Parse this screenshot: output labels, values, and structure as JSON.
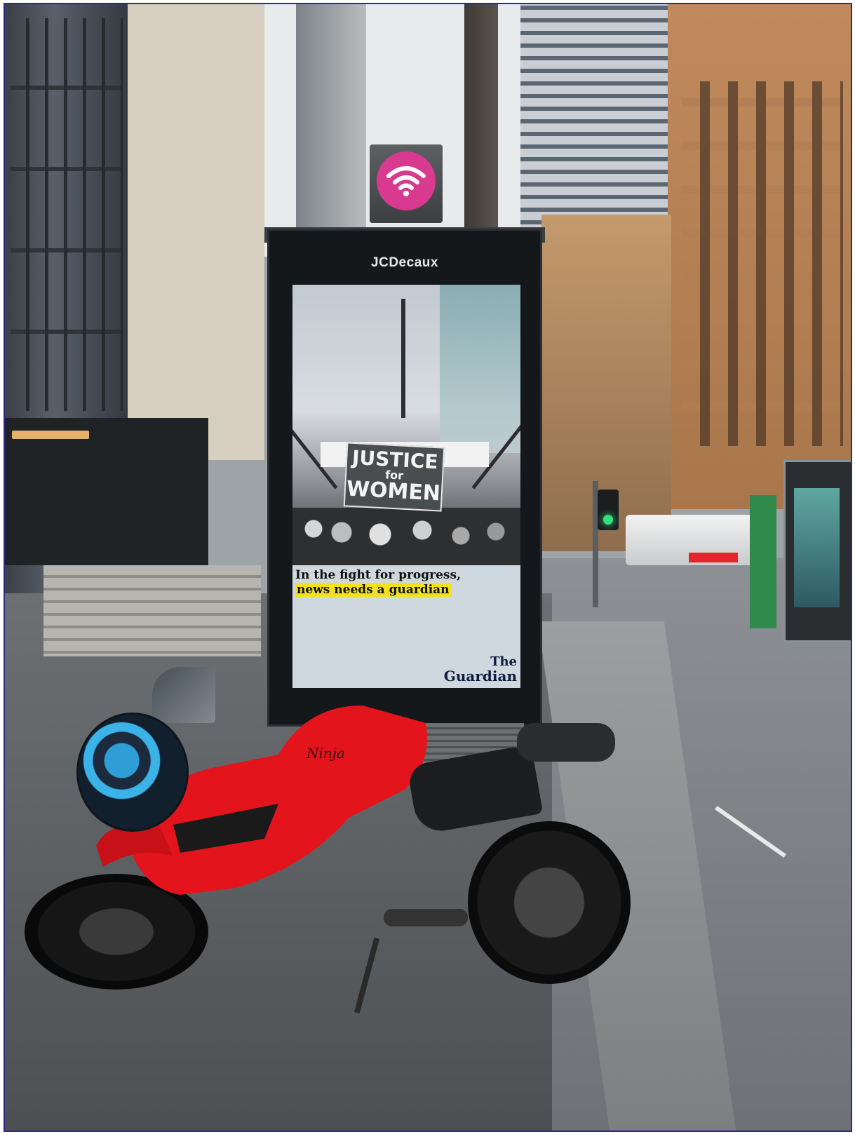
{
  "kiosk": {
    "brand": "JCDecaux"
  },
  "advert": {
    "sign_line1": "JUSTICE",
    "sign_line2": "for",
    "sign_line3": "WOMEN",
    "tagline_line1": "In the fight for progress,",
    "tagline_line2": "news needs a guardian",
    "logo_line1": "The",
    "logo_line2": "Guardian",
    "highlight_color": "#f3e21b"
  },
  "bike": {
    "model_text": "Ninja",
    "body_color": "#e4141c"
  },
  "icons": {
    "wifi": "wifi-icon"
  },
  "colors": {
    "wifi_badge": "#d83a8f",
    "traffic_light": "#33e07a"
  }
}
